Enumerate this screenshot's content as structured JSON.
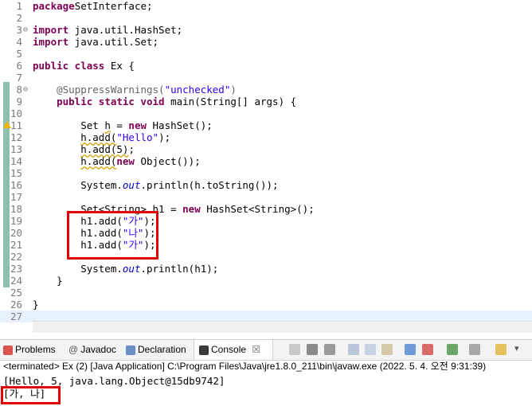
{
  "editor": {
    "lines": [
      {
        "n": "1",
        "parts": [
          [
            "kw",
            "package"
          ],
          [
            "",
            "SetInterface;"
          ]
        ]
      },
      {
        "n": "2",
        "parts": []
      },
      {
        "n": "3",
        "fold": "⊖",
        "parts": [
          [
            "kw",
            "import"
          ],
          [
            "",
            " java.util.HashSet;"
          ]
        ]
      },
      {
        "n": "4",
        "parts": [
          [
            "kw",
            "import"
          ],
          [
            "",
            " java.util.Set;"
          ]
        ]
      },
      {
        "n": "5",
        "parts": []
      },
      {
        "n": "6",
        "parts": [
          [
            "kw",
            "public class"
          ],
          [
            "",
            " Ex {"
          ]
        ]
      },
      {
        "n": "7",
        "parts": []
      },
      {
        "n": "8",
        "fold": "⊖",
        "parts": [
          [
            "ann",
            "    @SuppressWarnings("
          ],
          [
            "str",
            "\"unchecked\""
          ],
          [
            "ann",
            ")"
          ]
        ]
      },
      {
        "n": "9",
        "parts": [
          [
            "",
            "    "
          ],
          [
            "kw",
            "public static void"
          ],
          [
            "",
            " main(String[] args) {"
          ]
        ]
      },
      {
        "n": "10",
        "parts": []
      },
      {
        "n": "11",
        "warn": true,
        "parts": [
          [
            "",
            "        Set "
          ],
          [
            "warnu",
            "h"
          ],
          [
            "",
            " = "
          ],
          [
            "kw",
            "new"
          ],
          [
            "",
            " HashSet();"
          ]
        ]
      },
      {
        "n": "12",
        "parts": [
          [
            "",
            "        "
          ],
          [
            "warnu",
            "h.add("
          ],
          [
            "str",
            "\"Hello\""
          ],
          [
            "",
            ");"
          ]
        ]
      },
      {
        "n": "13",
        "parts": [
          [
            "",
            "        "
          ],
          [
            "warnu",
            "h.add(5)"
          ],
          [
            "",
            ";"
          ]
        ]
      },
      {
        "n": "14",
        "parts": [
          [
            "",
            "        "
          ],
          [
            "warnu",
            "h.add("
          ],
          [
            "kw",
            "new"
          ],
          [
            "",
            " Object());"
          ]
        ]
      },
      {
        "n": "15",
        "parts": []
      },
      {
        "n": "16",
        "parts": [
          [
            "",
            "        System."
          ],
          [
            "fld",
            "out"
          ],
          [
            "",
            ".println(h.toString());"
          ]
        ]
      },
      {
        "n": "17",
        "parts": []
      },
      {
        "n": "18",
        "parts": [
          [
            "",
            "        Set<String> h1 = "
          ],
          [
            "kw",
            "new"
          ],
          [
            "",
            " HashSet<String>();"
          ]
        ]
      },
      {
        "n": "19",
        "parts": [
          [
            "",
            "        h1.add("
          ],
          [
            "str",
            "\"가\""
          ],
          [
            "",
            ");"
          ]
        ]
      },
      {
        "n": "20",
        "parts": [
          [
            "",
            "        h1.add("
          ],
          [
            "str",
            "\"나\""
          ],
          [
            "",
            ");"
          ]
        ]
      },
      {
        "n": "21",
        "parts": [
          [
            "",
            "        h1.add("
          ],
          [
            "str",
            "\"가\""
          ],
          [
            "",
            ");"
          ]
        ]
      },
      {
        "n": "22",
        "parts": []
      },
      {
        "n": "23",
        "parts": [
          [
            "",
            "        System."
          ],
          [
            "fld",
            "out"
          ],
          [
            "",
            ".println(h1);"
          ]
        ]
      },
      {
        "n": "24",
        "parts": [
          [
            "",
            "    }"
          ]
        ]
      },
      {
        "n": "25",
        "parts": []
      },
      {
        "n": "26",
        "parts": [
          [
            "",
            "}"
          ]
        ]
      },
      {
        "n": "27",
        "hl": true,
        "parts": []
      }
    ]
  },
  "views": {
    "problems": "Problems",
    "javadoc": "Javadoc",
    "declaration": "Declaration",
    "console": "Console",
    "console_close": "☒"
  },
  "console": {
    "status": "<terminated> Ex (2) [Java Application] C:\\Program Files\\Java\\jre1.8.0_211\\bin\\javaw.exe (2022. 5. 4. 오전 9:31:39)",
    "output_line1": "[Hello, 5, java.lang.Object@15db9742]",
    "output_line2": "[가, 나]"
  },
  "colors": {
    "keyword": "#7f0055",
    "string": "#2a00ff",
    "annotation": "#646464",
    "highlight_box": "#e00000"
  }
}
